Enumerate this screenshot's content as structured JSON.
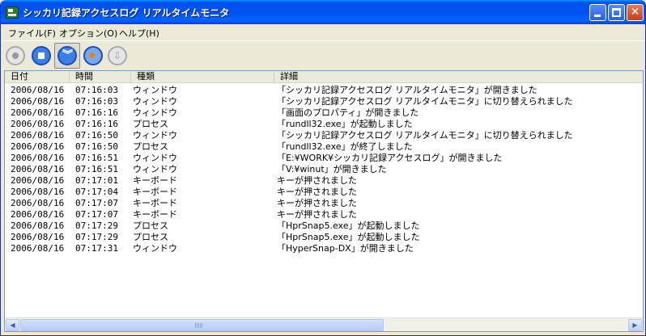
{
  "window": {
    "title": "シッカリ記録アクセスログ リアルタイムモニタ"
  },
  "menu": [
    "ファイル(F)",
    "オプション(O)",
    "ヘルプ(H)"
  ],
  "toolbar": {
    "icons": [
      "record-icon",
      "stop-icon",
      "autoscroll-icon",
      "clear-icon",
      "download-icon"
    ],
    "active": "autoscroll-icon"
  },
  "columns": [
    "日付",
    "時間",
    "種類",
    "詳細"
  ],
  "rows": [
    [
      "2006/08/16",
      "07:16:03",
      "ウィンドウ",
      "「シッカリ記録アクセスログ リアルタイムモニタ」が開きました"
    ],
    [
      "2006/08/16",
      "07:16:03",
      "ウィンドウ",
      "「シッカリ記録アクセスログ リアルタイムモニタ」に切り替えられました"
    ],
    [
      "2006/08/16",
      "07:16:16",
      "ウィンドウ",
      "「画面のプロパティ」が開きました"
    ],
    [
      "2006/08/16",
      "07:16:16",
      "プロセス",
      "「rundll32.exe」が起動しました"
    ],
    [
      "2006/08/16",
      "07:16:50",
      "ウィンドウ",
      "「シッカリ記録アクセスログ リアルタイムモニタ」に切り替えられました"
    ],
    [
      "2006/08/16",
      "07:16:50",
      "プロセス",
      "「rundll32.exe」が終了しました"
    ],
    [
      "2006/08/16",
      "07:16:51",
      "ウィンドウ",
      "「E:¥WORK¥シッカリ記録アクセスログ」が開きました"
    ],
    [
      "2006/08/16",
      "07:16:51",
      "ウィンドウ",
      "「V:¥winut」が開きました"
    ],
    [
      "2006/08/16",
      "07:17:01",
      "キーボード",
      "キーが押されました"
    ],
    [
      "2006/08/16",
      "07:17:04",
      "キーボード",
      "キーが押されました"
    ],
    [
      "2006/08/16",
      "07:17:07",
      "キーボード",
      "キーが押されました"
    ],
    [
      "2006/08/16",
      "07:17:07",
      "キーボード",
      "キーが押されました"
    ],
    [
      "2006/08/16",
      "07:17:29",
      "プロセス",
      "「HprSnap5.exe」が起動しました"
    ],
    [
      "2006/08/16",
      "07:17:29",
      "プロセス",
      "「HprSnap5.exe」が起動しました"
    ],
    [
      "2006/08/16",
      "07:17:31",
      "ウィンドウ",
      "「HyperSnap-DX」が開きました"
    ]
  ]
}
